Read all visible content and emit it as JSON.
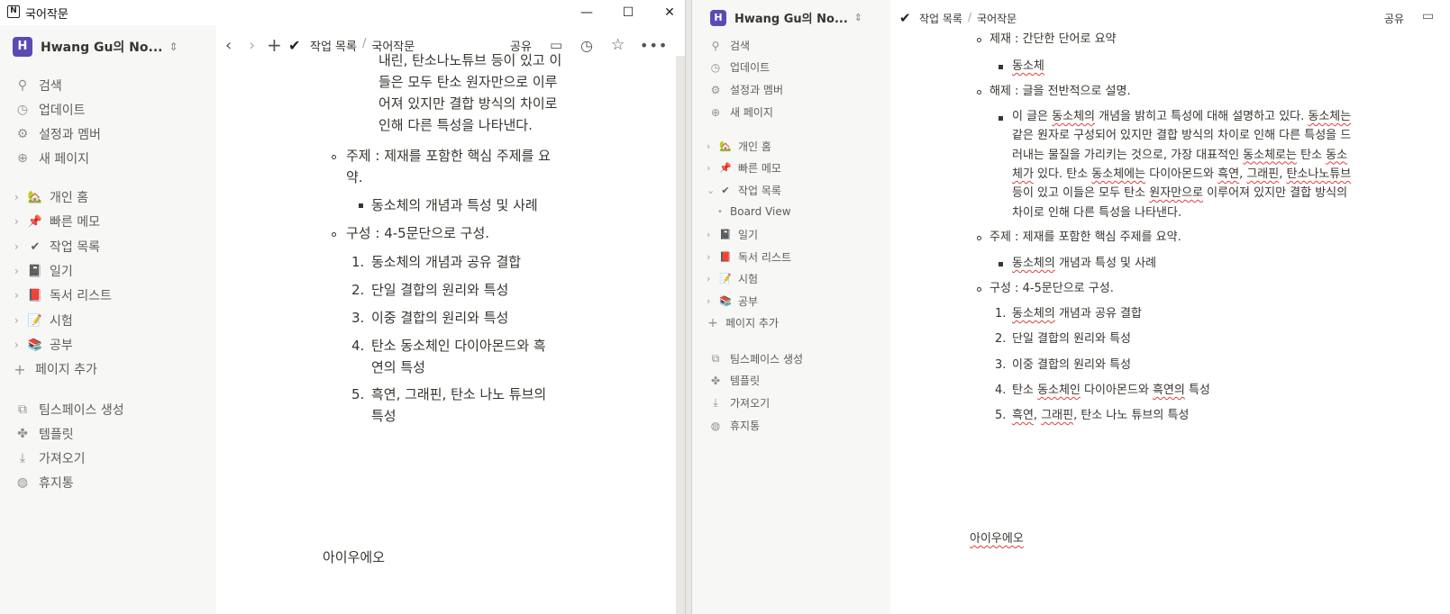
{
  "left_window": {
    "title": "국어작문",
    "controls": {
      "minimize": "—",
      "maximize": "☐",
      "close": "✕"
    },
    "workspace": {
      "avatar": "H",
      "name": "Hwang Gu의 No..."
    },
    "sidebar": {
      "top_items": [
        {
          "label": "검색",
          "icon": "search-icon"
        },
        {
          "label": "업데이트",
          "icon": "clock-icon"
        },
        {
          "label": "설정과 멤버",
          "icon": "gear-icon"
        },
        {
          "label": "새 페이지",
          "icon": "plus-circle-icon"
        }
      ],
      "pages": [
        {
          "label": "개인 홈",
          "emoji": "🏡"
        },
        {
          "label": "빠른 메모",
          "emoji": "📌"
        },
        {
          "label": "작업 목록",
          "emoji": "✔"
        },
        {
          "label": "일기",
          "emoji": "📓"
        },
        {
          "label": "독서 리스트",
          "emoji": "📕"
        },
        {
          "label": "시험",
          "emoji": "📝"
        },
        {
          "label": "공부",
          "emoji": "📚"
        }
      ],
      "add_page": "페이지 추가",
      "bottom_items": [
        {
          "label": "팀스페이스 생성",
          "icon": "teamspace-icon"
        },
        {
          "label": "템플릿",
          "icon": "template-icon"
        },
        {
          "label": "가져오기",
          "icon": "import-icon"
        },
        {
          "label": "휴지통",
          "icon": "trash-icon"
        }
      ]
    },
    "topbar": {
      "crumb1": "작업 목록",
      "crumb2": "국어작문",
      "share": "공유"
    },
    "content": {
      "lines_a": [
        "내린, 탄소나노튜브 등이 있고 이",
        "들은 모두 탄소 원자만으로 이루",
        "어져 있지만 결합 방식의 차이로",
        "인해 다른 특성을 나타낸다."
      ],
      "theme_1": "주제 : 제재를 포함한 핵심 주제를 요",
      "theme_2": "약.",
      "theme_sub": "동소체의 개념과 특성 및 사례",
      "structure": "구성 : 4-5문단으로 구성.",
      "ol": [
        {
          "n": "1.",
          "lines": [
            "동소체의 개념과 공유 결합"
          ]
        },
        {
          "n": "2.",
          "lines": [
            "단일 결합의 원리와 특성"
          ]
        },
        {
          "n": "3.",
          "lines": [
            "이중 결합의 원리와 특성"
          ]
        },
        {
          "n": "4.",
          "lines": [
            "탄소 동소체인 다이아몬드와 흑",
            "연의 특성"
          ]
        },
        {
          "n": "5.",
          "lines": [
            "흑연, 그래핀, 탄소 나노 튜브의",
            "특성"
          ]
        }
      ],
      "footer_text": "아이우에오"
    }
  },
  "right_window": {
    "workspace": {
      "avatar": "H",
      "name": "Hwang Gu의 No..."
    },
    "sidebar": {
      "top_items": [
        "검색",
        "업데이트",
        "설정과 멤버",
        "새 페이지"
      ],
      "pages": [
        {
          "label": "개인 홈",
          "emoji": "🏡"
        },
        {
          "label": "빠른 메모",
          "emoji": "📌"
        },
        {
          "label": "작업 목록",
          "emoji": "✔"
        },
        {
          "label": "Board View",
          "emoji": ""
        },
        {
          "label": "일기",
          "emoji": "📓"
        },
        {
          "label": "독서 리스트",
          "emoji": "📕"
        },
        {
          "label": "시험",
          "emoji": "📝"
        },
        {
          "label": "공부",
          "emoji": "📚"
        }
      ],
      "add_page": "페이지 추가",
      "bottom_items": [
        "팀스페이스 생성",
        "템플릿",
        "가져오기",
        "휴지통"
      ]
    },
    "topbar": {
      "crumb1": "작업 목록",
      "crumb2": "국어작문",
      "share": "공유"
    },
    "content": {
      "subject": "제재 : 간단한 단어로 요약",
      "subject_sub": "동소체",
      "explain": "해제 : 글을 전반적으로 설명.",
      "para": [
        "이 글은 동소체의 개념을 밝히고 특성에 대해 설명하고 있다. 동소체는",
        "같은 원자로 구성되어 있지만 결합 방식의 차이로 인해 다른 특성을 드",
        "러내는 물질을 가리키는 것으로, 가장 대표적인 동소체로는 탄소 동소",
        "체가 있다. 탄소 동소체에는 다이아몬드와 흑연, 그래핀, 탄소나노튜브",
        "등이 있고 이들은 모두 탄소 원자만으로 이루어져 있지만 결합 방식의",
        "차이로 인해 다른 특성을 나타낸다."
      ],
      "theme": "주제 : 제재를 포함한 핵심 주제를 요약.",
      "theme_sub": "동소체의 개념과 특성 및 사례",
      "structure": "구성 : 4-5문단으로 구성.",
      "ol": [
        {
          "n": "1.",
          "text": "동소체의 개념과 공유 결합"
        },
        {
          "n": "2.",
          "text": "단일 결합의 원리와 특성"
        },
        {
          "n": "3.",
          "text": "이중 결합의 원리와 특성"
        },
        {
          "n": "4.",
          "text": "탄소 동소체인 다이아몬드와 흑연의 특성"
        },
        {
          "n": "5.",
          "text": "흑연, 그래핀, 탄소 나노 튜브의 특성"
        }
      ],
      "footer_text": "아이우에오"
    }
  }
}
